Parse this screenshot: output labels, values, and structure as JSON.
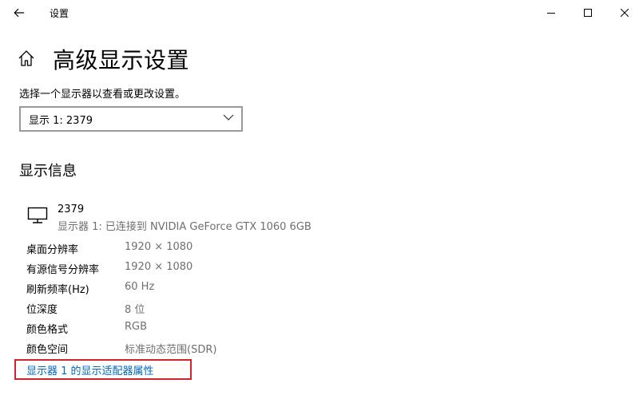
{
  "window": {
    "title": "设置",
    "back_icon": "arrow-left-icon",
    "controls": [
      "minimize-icon",
      "maximize-icon",
      "close-icon"
    ]
  },
  "page": {
    "title": "高级显示设置",
    "home_icon": "home-icon",
    "select_label": "选择一个显示器以查看或更改设置。",
    "display_dropdown": {
      "selected": "显示 1: 2379",
      "icon": "chevron-down-icon"
    }
  },
  "display_info": {
    "section_title": "显示信息",
    "monitor": {
      "icon": "monitor-icon",
      "name": "2379",
      "connection": "显示器 1: 已连接到 NVIDIA GeForce GTX 1060 6GB"
    },
    "rows": [
      {
        "key": "桌面分辨率",
        "value": "1920 × 1080"
      },
      {
        "key": "有源信号分辨率",
        "value": "1920 × 1080"
      },
      {
        "key": "刷新频率(Hz)",
        "value": "60 Hz"
      },
      {
        "key": "位深度",
        "value": "8 位"
      },
      {
        "key": "颜色格式",
        "value": "RGB"
      },
      {
        "key": "颜色空间",
        "value": "标准动态范围(SDR)"
      }
    ],
    "adapter_link": "显示器 1 的显示适配器属性"
  },
  "colors": {
    "link": "#0067b8",
    "highlight": "#d1232a",
    "secondary_text": "#6f6f6f"
  }
}
